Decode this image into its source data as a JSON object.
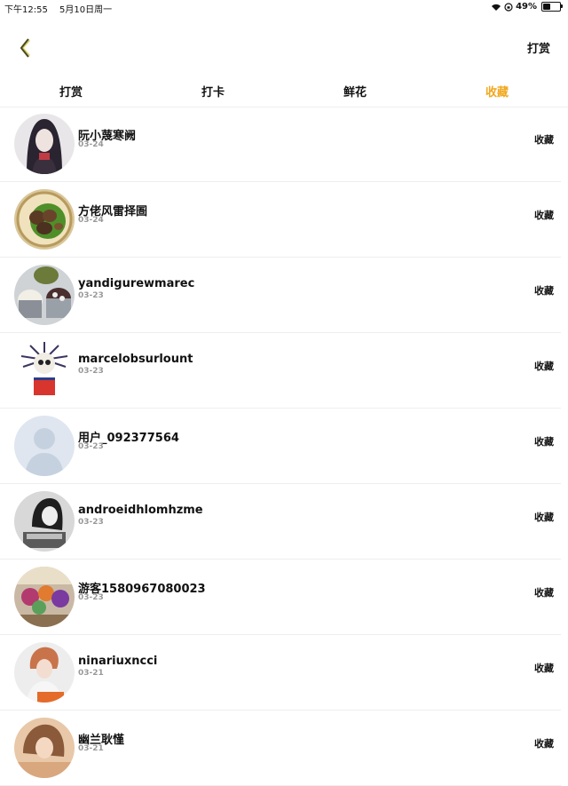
{
  "status_bar": {
    "time": "下午12:55",
    "date": "5月10日周一",
    "battery": "49%"
  },
  "header": {
    "action_label": "打赏"
  },
  "tabs": [
    {
      "label": "打赏",
      "active": false
    },
    {
      "label": "打卡",
      "active": false
    },
    {
      "label": "鲜花",
      "active": false
    },
    {
      "label": "收藏",
      "active": true
    }
  ],
  "colors": {
    "accent": "#f0a81e",
    "divider": "#eeeeee",
    "muted": "#999999"
  },
  "items": [
    {
      "name": "阮小蔑寒阙",
      "date": "03-24",
      "status": "收藏",
      "avatar": "girl-portrait"
    },
    {
      "name": "方佬风雷择圄",
      "date": "03-24",
      "status": "收藏",
      "avatar": "food-plate"
    },
    {
      "name": "yandigurewmarec",
      "date": "03-23",
      "status": "收藏",
      "avatar": "dessert-cups"
    },
    {
      "name": "marcelobsurlount",
      "date": "03-23",
      "status": "收藏",
      "avatar": "skull-figure"
    },
    {
      "name": "用户_092377564",
      "date": "03-23",
      "status": "收藏",
      "avatar": "default-avatar"
    },
    {
      "name": "androeidhlomhzme",
      "date": "03-23",
      "status": "收藏",
      "avatar": "bw-portrait"
    },
    {
      "name": "游客1580967080023",
      "date": "03-23",
      "status": "收藏",
      "avatar": "colorful-scene"
    },
    {
      "name": "ninariuxncci",
      "date": "03-21",
      "status": "收藏",
      "avatar": "boy-portrait"
    },
    {
      "name": "幽兰耿慬",
      "date": "03-21",
      "status": "收藏",
      "avatar": "warm-portrait"
    }
  ]
}
